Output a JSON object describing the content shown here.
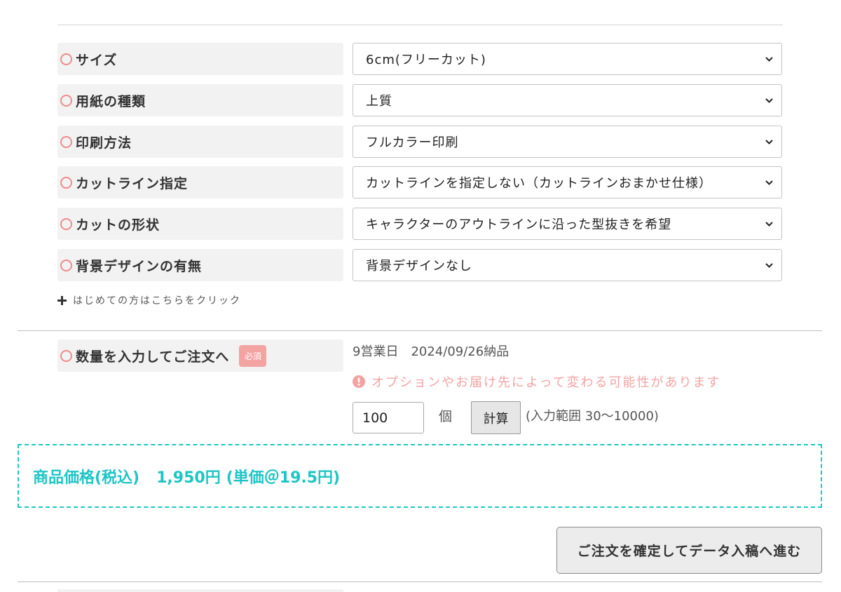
{
  "options": [
    {
      "label": "サイズ",
      "value": "6cm(フリーカット)"
    },
    {
      "label": "用紙の種類",
      "value": "上質"
    },
    {
      "label": "印刷方法",
      "value": "フルカラー印刷"
    },
    {
      "label": "カットライン指定",
      "value": "カットラインを指定しない（カットラインおまかせ仕様）"
    },
    {
      "label": "カットの形状",
      "value": "キャラクターのアウトラインに沿った型抜きを希望"
    },
    {
      "label": "背景デザインの有無",
      "value": "背景デザインなし"
    }
  ],
  "first_time_link": {
    "icon": "plus-icon",
    "label": "はじめての方はこちらをクリック"
  },
  "quantity": {
    "label": "数量を入力してご注文へ",
    "required_badge": "必須",
    "delivery": "9営業日　2024/09/26納品",
    "notice_icon": "exclamation-icon",
    "notice": "オプションやお届け先によって変わる可能性があります",
    "value": "100",
    "unit": "個",
    "calc_button": "計算",
    "range": "(入力範囲 30〜10000)"
  },
  "price": {
    "label": "商品価格(税込)",
    "total": "1,950円",
    "unit_price": "(単価＠19.5円)"
  },
  "submit_button": "ご注文を確定してデータ入稿へ進む",
  "colors": {
    "ring_pink": "#f08c8c",
    "notice_pink": "#f4a3a3",
    "price_teal": "#1fc5c5",
    "label_background": "#f2f2f2",
    "button_background": "#ececec"
  }
}
